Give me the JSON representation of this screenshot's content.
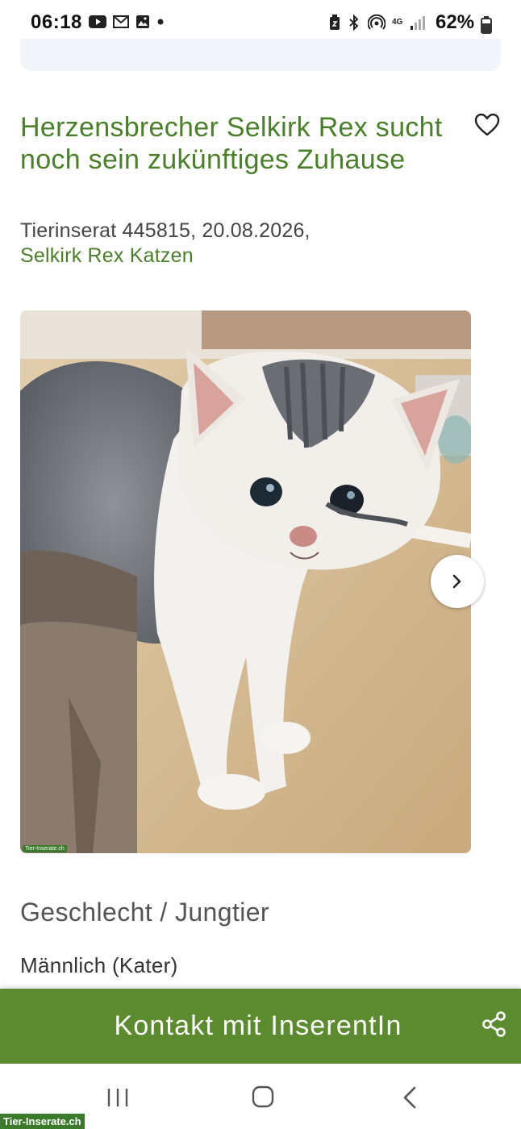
{
  "status_bar": {
    "time": "06:18",
    "battery_percent": "62%",
    "network": "4G"
  },
  "listing": {
    "title": "Herzensbrecher Selkirk Rex sucht noch sein zukünftiges Zuhause",
    "meta": "Tierinserat 445815, 20.08.2026,",
    "category_link": "Selkirk Rex Katzen",
    "photo_watermark": "Tier-Inserate.ch"
  },
  "details": {
    "heading": "Geschlecht / Jungtier",
    "value": "Männlich (Kater)"
  },
  "contact": {
    "label": "Kontakt mit InserentIn"
  },
  "footer_watermark": "Tier-Inserate.ch",
  "colors": {
    "accent_green": "#4a7f2a",
    "contact_bar": "#5c8a2e"
  }
}
